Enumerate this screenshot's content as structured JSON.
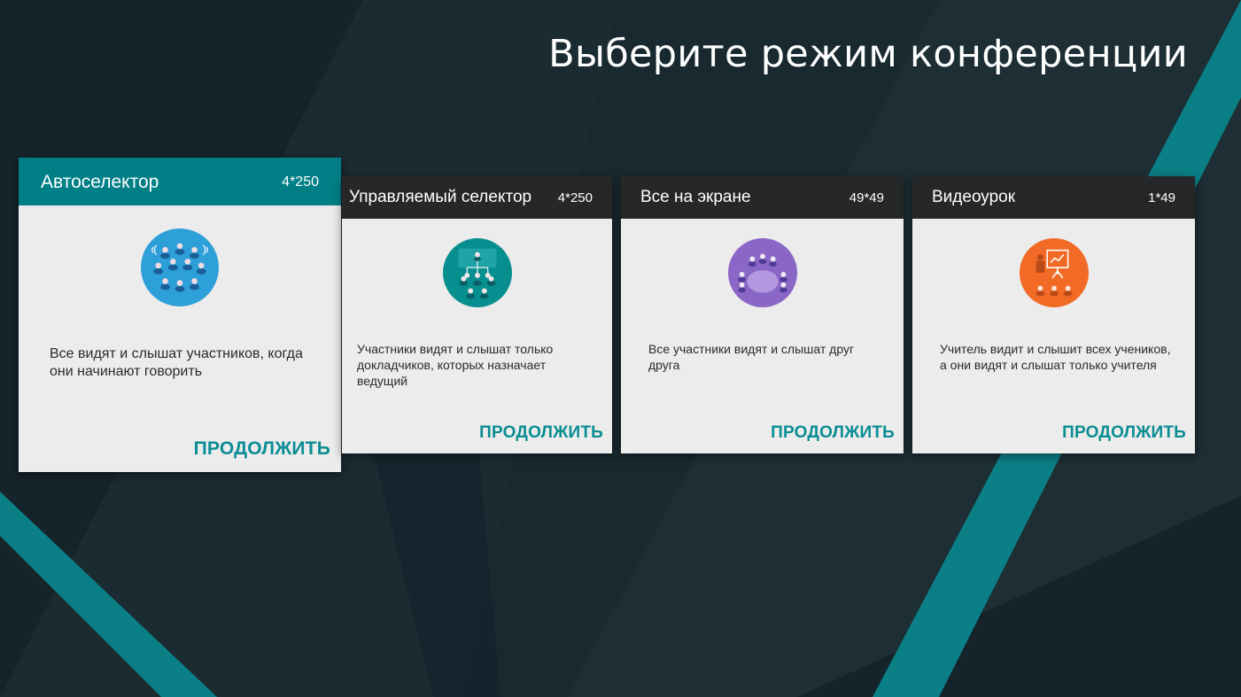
{
  "title": "Выберите режим конференции",
  "colors": {
    "background": "#15232a",
    "accent": "#0a8d93",
    "selected_header": "#007f86",
    "card_header": "#262728",
    "card_body": "#ececec"
  },
  "cards": [
    {
      "name": "Автоселектор",
      "capacity": "4*250",
      "icon": "audience-sound-icon",
      "icon_color": "#2d9fd9",
      "description": "Все видят и слышат участников, когда они начинают говорить",
      "action": "ПРОДОЛЖИТЬ",
      "selected": true
    },
    {
      "name": "Управляемый селектор",
      "capacity": "4*250",
      "icon": "presenter-hierarchy-icon",
      "icon_color": "#078e8e",
      "description": "Участники видят и слышат только докладчиков, которых назначает ведущий",
      "action": "ПРОДОЛЖИТЬ",
      "selected": false
    },
    {
      "name": "Все на экране",
      "capacity": "49*49",
      "icon": "round-table-icon",
      "icon_color": "#8a67c6",
      "description": "Все участники видят и слышат друг друга",
      "action": "ПРОДОЛЖИТЬ",
      "selected": false
    },
    {
      "name": "Видеоурок",
      "capacity": "1*49",
      "icon": "teacher-board-icon",
      "icon_color": "#f26b26",
      "description": "Учитель видит и слышит всех учеников, а они видят и слышат только учителя",
      "action": "ПРОДОЛЖИТЬ",
      "selected": false
    }
  ]
}
